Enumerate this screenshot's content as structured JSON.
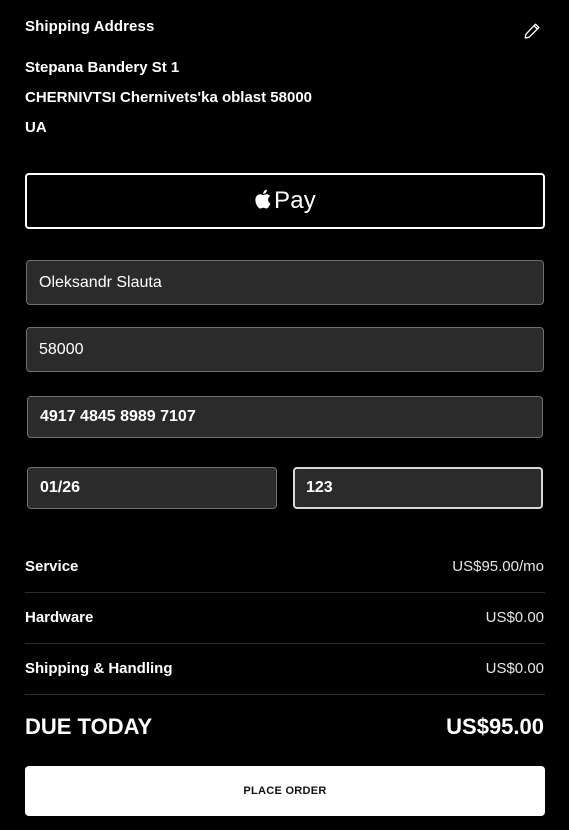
{
  "shipping": {
    "title": "Shipping Address",
    "line1": "Stepana Bandery St 1",
    "line2": "CHERNIVTSI Chernivets'ka oblast 58000",
    "line3": "UA",
    "edit_icon": "pencil-icon"
  },
  "apple_pay": {
    "label": "Pay",
    "icon": "apple-logo-icon"
  },
  "form": {
    "name_value": "Oleksandr Slauta",
    "zip_value": "58000",
    "card_value": "4917 4845 8989 7107",
    "expiry_value": "01/26",
    "cvv_value": "123"
  },
  "summary": {
    "rows": [
      {
        "label": "Service",
        "value": "US$95.00/mo"
      },
      {
        "label": "Hardware",
        "value": "US$0.00"
      },
      {
        "label": "Shipping & Handling",
        "value": "US$0.00"
      }
    ],
    "due_label": "DUE TODAY",
    "due_value": "US$95.00"
  },
  "actions": {
    "place_order_label": "PLACE ORDER"
  },
  "colors": {
    "background": "#000000",
    "field_background": "#2b2b2b",
    "field_border": "#6f6f6f",
    "button_background": "#ffffff"
  }
}
